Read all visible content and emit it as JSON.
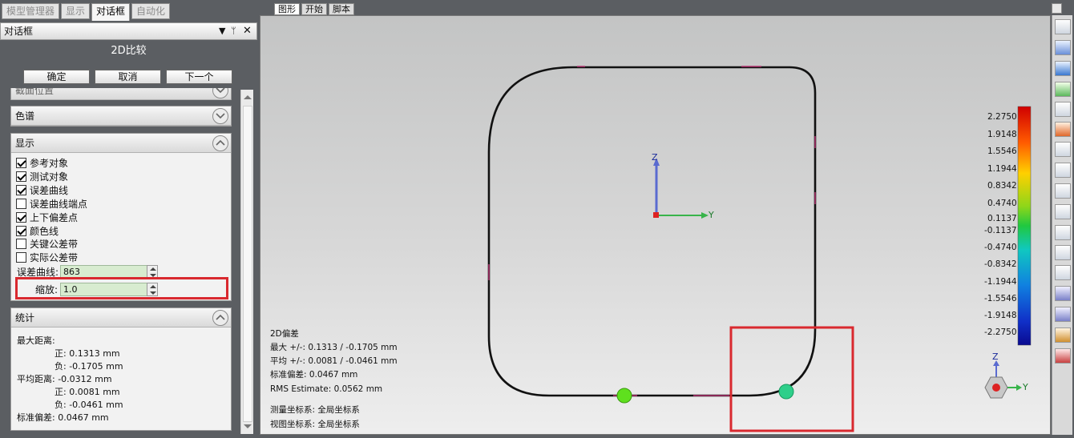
{
  "top_tabs": [
    "模型管理器",
    "显示",
    "对话框",
    "自动化"
  ],
  "top_tabs_active_index": 2,
  "panel": {
    "title": "对话框",
    "pin_label": "▾ ᛘ ✕",
    "dialog_title": "2D比较",
    "buttons": {
      "ok": "确定",
      "cancel": "取消",
      "next": "下一个"
    }
  },
  "sections": {
    "cropped_header": "截面位置",
    "color_scale": "色谱",
    "display": "显示",
    "statistics": "统计"
  },
  "display_options": [
    {
      "label": "参考对象",
      "checked": true
    },
    {
      "label": "测试对象",
      "checked": true
    },
    {
      "label": "误差曲线",
      "checked": true
    },
    {
      "label": "误差曲线端点",
      "checked": false
    },
    {
      "label": "上下偏差点",
      "checked": true
    },
    {
      "label": "颜色线",
      "checked": true
    },
    {
      "label": "关键公差带",
      "checked": false
    },
    {
      "label": "实际公差带",
      "checked": false
    }
  ],
  "error_curve": {
    "label": "误差曲线:",
    "value": "863"
  },
  "scale": {
    "label": "缩放:",
    "value": "1.0"
  },
  "stats": {
    "max_label": "最大距离:",
    "max_pos": "正: 0.1313 mm",
    "max_neg": "负: -0.1705 mm",
    "avg_label": "平均距离: -0.0312 mm",
    "avg_pos": "正: 0.0081 mm",
    "avg_neg": "负: -0.0461 mm",
    "std": "标准偏差: 0.0467 mm"
  },
  "graphics_tabs": [
    "图形",
    "开始",
    "脚本"
  ],
  "graphics_tabs_active_index": 0,
  "axis_labels": {
    "z": "Z",
    "y": "Y"
  },
  "overlay": {
    "title": "2D偏差",
    "max": "最大 +/-: 0.1313 / -0.1705 mm",
    "avg": "平均 +/-: 0.0081 / -0.0461 mm",
    "std": "标准偏差: 0.0467 mm",
    "rms": "RMS Estimate: 0.0562 mm",
    "measure_cs": "测量坐标系: 全局坐标系",
    "view_cs": "视图坐标系: 全局坐标系"
  },
  "color_scale_values": [
    "2.2750",
    "1.9148",
    "1.5546",
    "1.1944",
    "0.8342",
    "0.4740",
    "0.1137",
    "-0.1137",
    "-0.4740",
    "-0.8342",
    "-1.1944",
    "-1.5546",
    "-1.9148",
    "-2.2750"
  ],
  "colors": {
    "highlight_box": "#d9292f",
    "curve": "#111111",
    "marker_green": "#5fe01e",
    "marker_teal": "#2ecf8a"
  }
}
